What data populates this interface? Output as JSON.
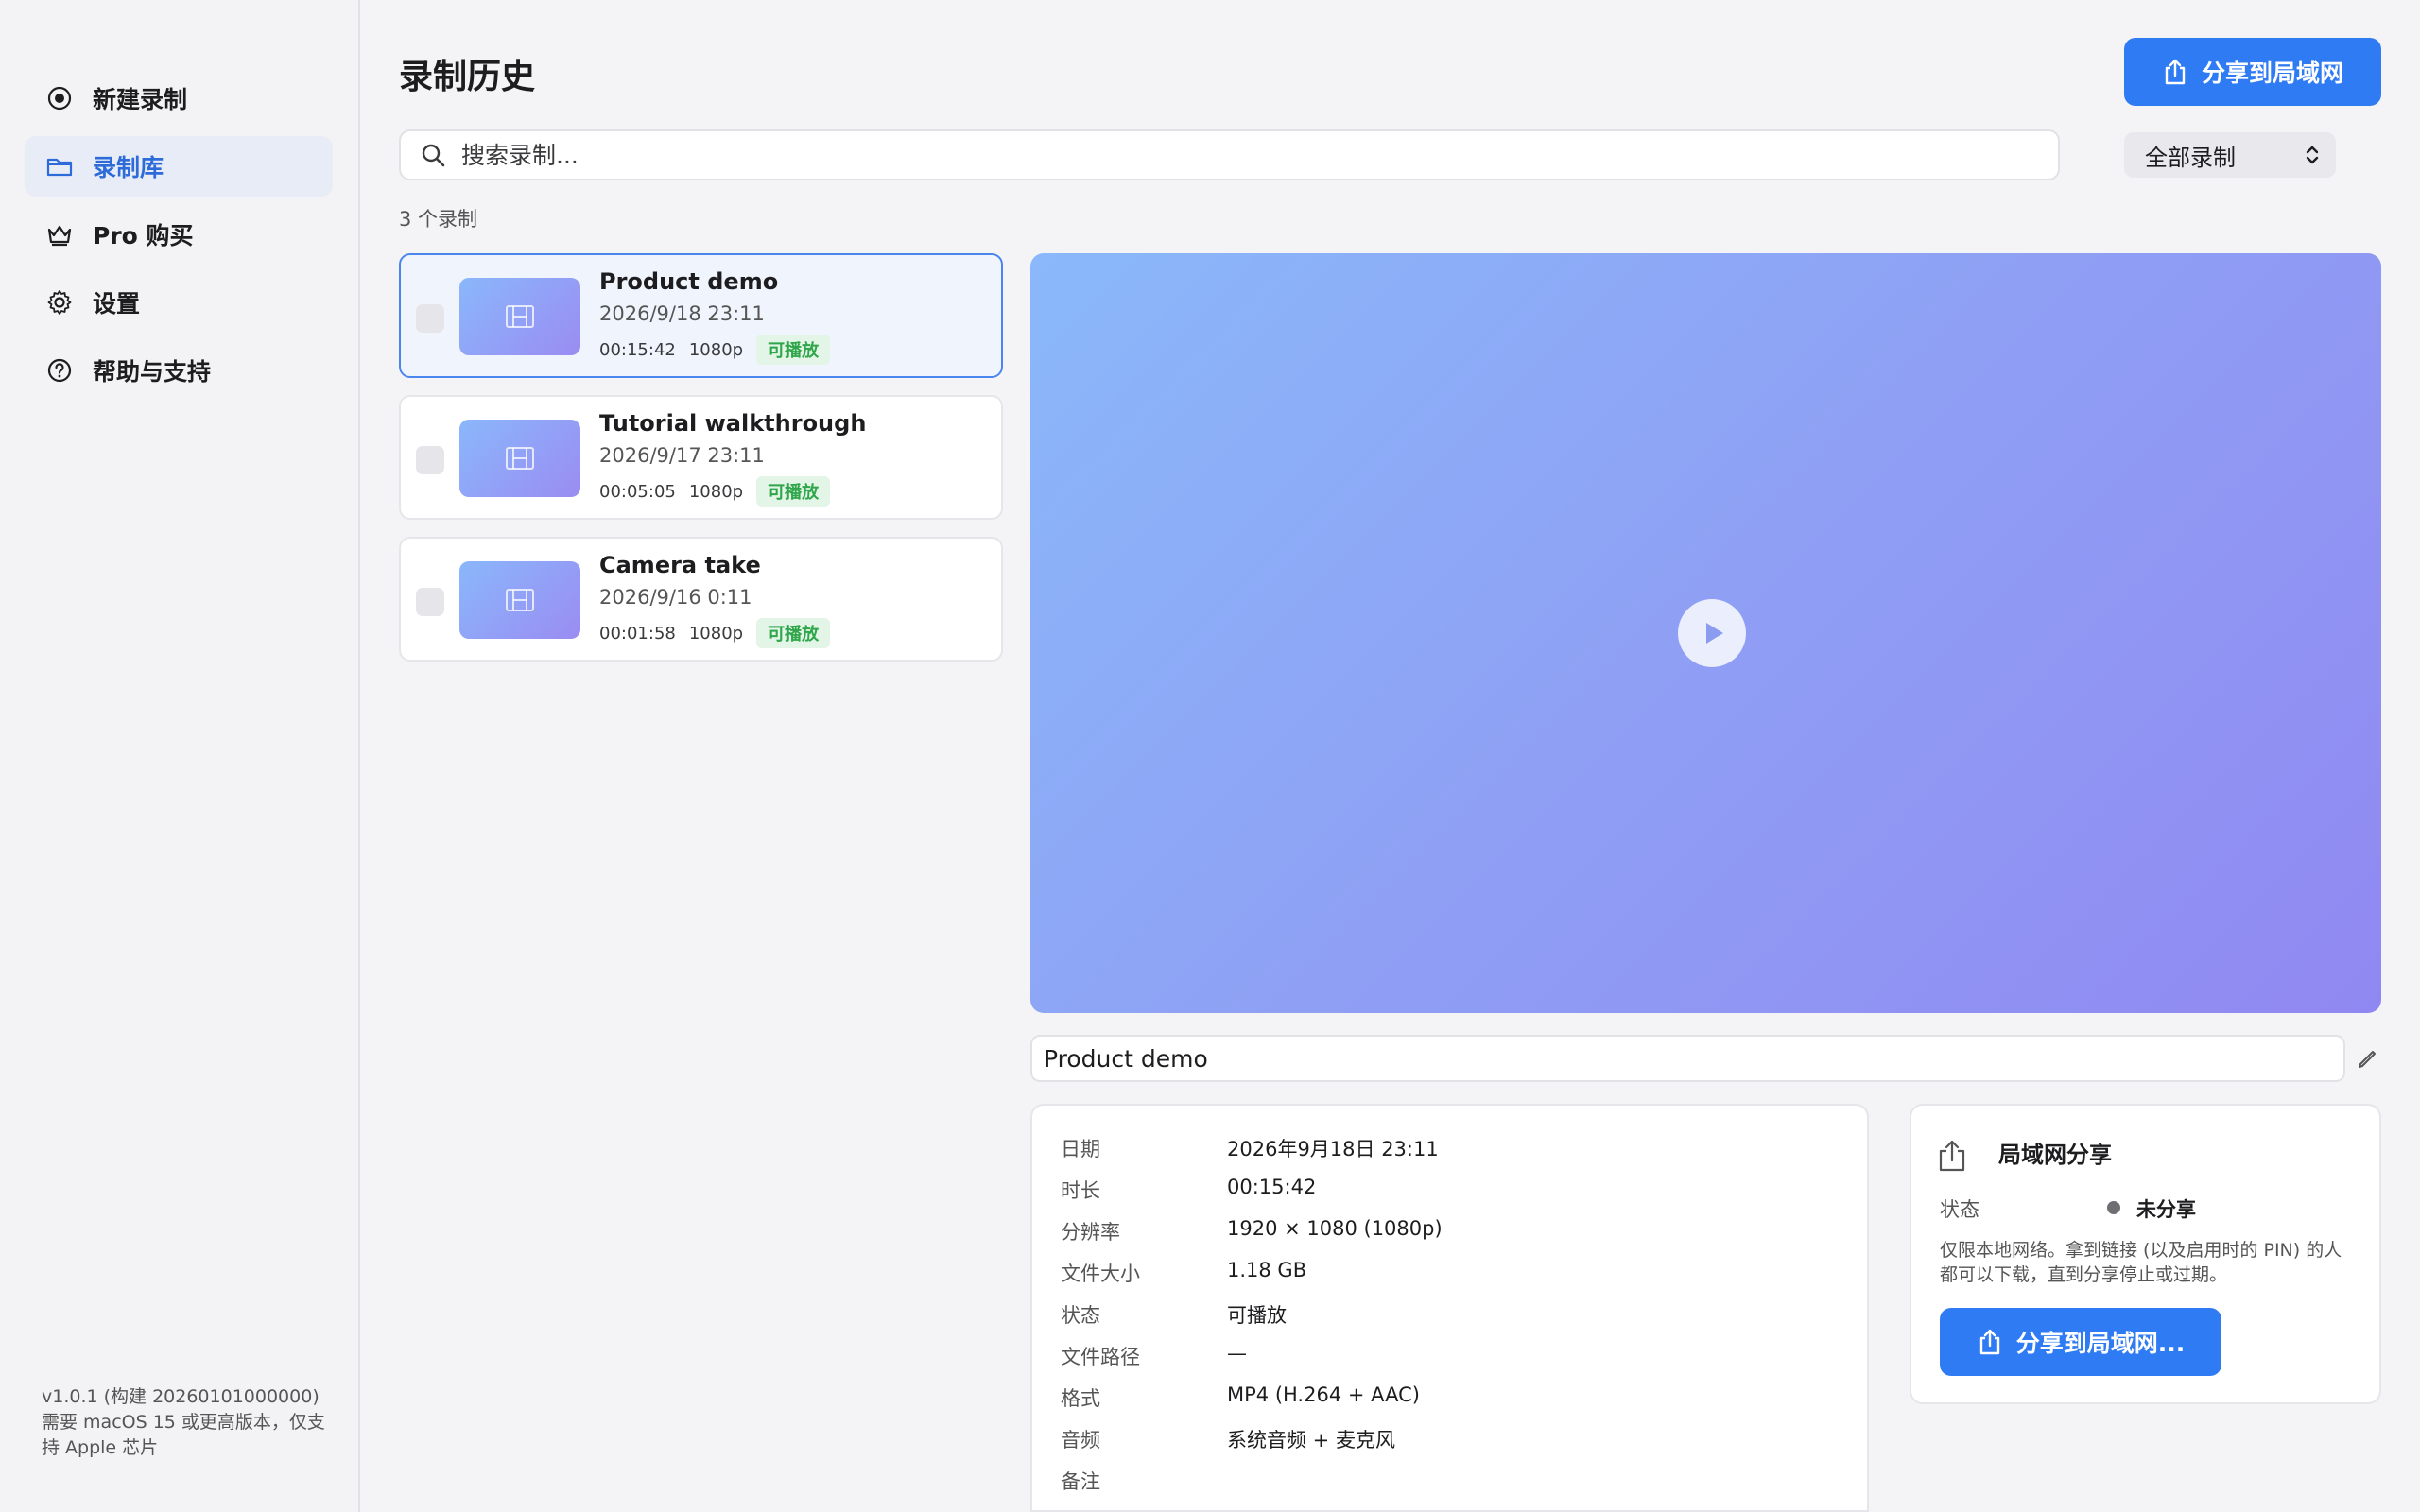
{
  "sidebar": {
    "items": [
      {
        "label": "新建录制",
        "icon": "record-icon"
      },
      {
        "label": "录制库",
        "icon": "folder-icon"
      },
      {
        "label": "Pro 购买",
        "icon": "crown-icon"
      },
      {
        "label": "设置",
        "icon": "gear-icon"
      },
      {
        "label": "帮助与支持",
        "icon": "help-icon"
      }
    ],
    "active_index": 1,
    "footer_version": "v1.0.1 (构建 20260101000000)",
    "footer_note": "需要 macOS 15 或更高版本，仅支持 Apple 芯片"
  },
  "header": {
    "title": "录制历史",
    "share_button": "分享到局域网"
  },
  "search": {
    "placeholder": "搜索录制..."
  },
  "filter": {
    "selected": "全部录制"
  },
  "list": {
    "count_label": "3 个录制",
    "recordings": [
      {
        "title": "Product demo",
        "date": "2026/9/18 23:11",
        "duration": "00:15:42",
        "resolution": "1080p",
        "status": "可播放",
        "selected": true
      },
      {
        "title": "Tutorial walkthrough",
        "date": "2026/9/17 23:11",
        "duration": "00:05:05",
        "resolution": "1080p",
        "status": "可播放",
        "selected": false
      },
      {
        "title": "Camera take",
        "date": "2026/9/16 0:11",
        "duration": "00:01:58",
        "resolution": "1080p",
        "status": "可播放",
        "selected": false
      }
    ]
  },
  "detail": {
    "name_value": "Product demo",
    "info": [
      {
        "key": "日期",
        "value": "2026年9月18日 23:11"
      },
      {
        "key": "时长",
        "value": "00:15:42"
      },
      {
        "key": "分辨率",
        "value": "1920 × 1080 (1080p)"
      },
      {
        "key": "文件大小",
        "value": "1.18 GB"
      },
      {
        "key": "状态",
        "value": "可播放"
      },
      {
        "key": "文件路径",
        "value": "—"
      },
      {
        "key": "格式",
        "value": "MP4 (H.264 + AAC)"
      },
      {
        "key": "音频",
        "value": "系统音频 + 麦克风"
      },
      {
        "key": "备注",
        "value": ""
      }
    ]
  },
  "lan_share": {
    "title": "局域网分享",
    "status_label": "状态",
    "status_value": "未分享",
    "description": "仅限本地网络。拿到链接 (以及启用时的 PIN) 的人都可以下载，直到分享停止或过期。",
    "button": "分享到局域网..."
  },
  "colors": {
    "accent": "#2f7bf3",
    "selected_bg": "#eff4fd",
    "playable_badge": "#2fa64a"
  }
}
